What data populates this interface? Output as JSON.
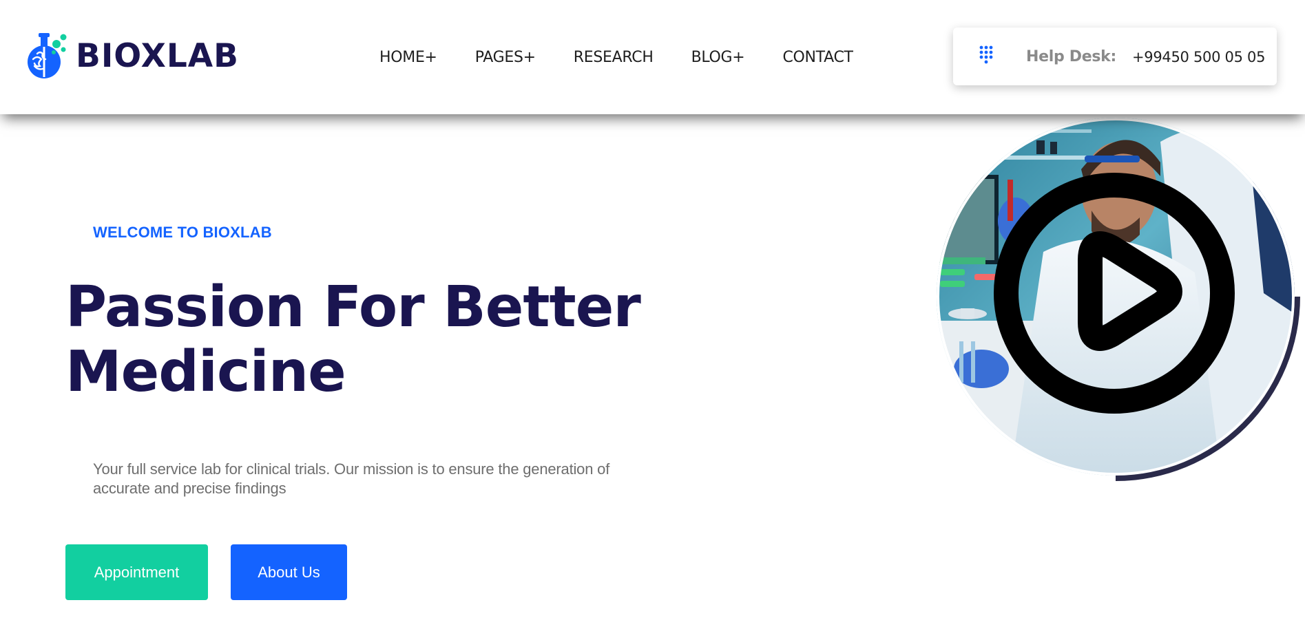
{
  "header": {
    "logo_text": "BIOXLAB",
    "nav": [
      {
        "label": "HOME+"
      },
      {
        "label": "PAGES+"
      },
      {
        "label": "RESEARCH"
      },
      {
        "label": "BLOG+"
      },
      {
        "label": "CONTACT"
      }
    ],
    "helpdesk": {
      "label": "Help Desk:",
      "phone": "+99450 500 05 05",
      "icon": "dialpad-icon"
    }
  },
  "hero": {
    "eyebrow": "WELCOME TO BIOXLAB",
    "title_line1": "Passion For Better",
    "title_line2": "Medicine",
    "description": "Your full service lab for clinical trials. Our mission is to ensure the generation of accurate and precise findings",
    "buttons": {
      "appointment": "Appointment",
      "about": "About Us"
    }
  },
  "video": {
    "icon": "play-icon"
  },
  "colors": {
    "brand_navy": "#1a1550",
    "accent_blue": "#1463ff",
    "accent_green": "#12cfa0",
    "text_gray": "#6e6e6e"
  }
}
